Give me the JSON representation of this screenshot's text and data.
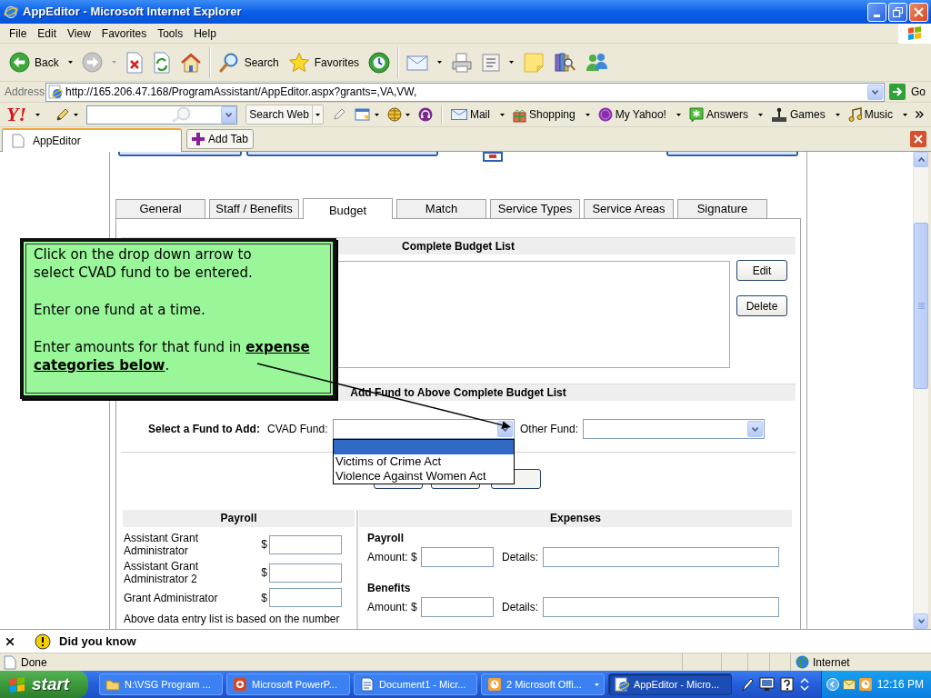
{
  "window": {
    "title": "AppEditor - Microsoft Internet Explorer"
  },
  "menu": [
    "File",
    "Edit",
    "View",
    "Favorites",
    "Tools",
    "Help"
  ],
  "toolbar": [
    {
      "kind": "back",
      "label": "Back",
      "dropdown": true
    },
    {
      "kind": "forward",
      "dropdown": true
    },
    {
      "kind": "stop"
    },
    {
      "kind": "refresh"
    },
    {
      "kind": "home"
    },
    {
      "kind": "separator"
    },
    {
      "kind": "search",
      "label": "Search"
    },
    {
      "kind": "favorites",
      "label": "Favorites"
    },
    {
      "kind": "history"
    },
    {
      "kind": "separator"
    },
    {
      "kind": "mail",
      "dropdown": true
    },
    {
      "kind": "print"
    },
    {
      "kind": "edit",
      "dropdown": true
    },
    {
      "kind": "note"
    },
    {
      "kind": "research"
    },
    {
      "kind": "messenger"
    }
  ],
  "address_bar": {
    "label": "Address",
    "url": "http://165.206.47.168/ProgramAssistant/AppEditor.aspx?grants=,VA,VW,",
    "go": "Go"
  },
  "yahoo_toolbar": {
    "items": [
      {
        "kind": "logo",
        "label": "Y!",
        "dropdown": true
      },
      {
        "kind": "pencil",
        "dropdown": true
      },
      {
        "kind": "search-field"
      },
      {
        "kind": "search-web",
        "label": "Search Web",
        "dropdown": true
      },
      {
        "kind": "highlight"
      },
      {
        "kind": "window",
        "dropdown": true
      },
      {
        "kind": "globe",
        "dropdown": true
      },
      {
        "kind": "headphones"
      },
      {
        "kind": "separator"
      },
      {
        "kind": "mail",
        "label": "Mail",
        "dropdown": true
      },
      {
        "kind": "shopping",
        "label": "Shopping",
        "dropdown": true
      },
      {
        "kind": "my-page",
        "label": "My Yahoo!",
        "dropdown": true
      },
      {
        "kind": "answers",
        "label": "Answers",
        "dropdown": true
      },
      {
        "kind": "games",
        "label": "Games",
        "dropdown": true
      },
      {
        "kind": "music",
        "label": "Music",
        "dropdown": true
      }
    ]
  },
  "browser_tabs": {
    "tabs": [
      {
        "label": "AppEditor",
        "selected": true
      }
    ],
    "add_tab": "Add Tab"
  },
  "page": {
    "tabs": [
      {
        "label": "General",
        "selected": false
      },
      {
        "label": "Staff / Benefits",
        "selected": false
      },
      {
        "label": "Budget",
        "selected": true
      },
      {
        "label": "Match",
        "selected": false
      },
      {
        "label": "Service Types",
        "selected": false
      },
      {
        "label": "Service Areas",
        "selected": false
      },
      {
        "label": "Signature",
        "selected": false
      }
    ],
    "budget_list": {
      "title": "Complete Budget List",
      "buttons": [
        "Edit",
        "Delete"
      ]
    },
    "add_fund": {
      "title": "Add Fund to Above Complete Budget List",
      "prompt": "Select a Fund to Add:",
      "cvad_fund": {
        "label": "CVAD Fund:",
        "expanded": true,
        "blank_option_highlighted": true,
        "options": [
          {
            "label": "Victims of Crime Act",
            "selected": false
          },
          {
            "label": "Violence Against Women Act",
            "selected": false
          }
        ]
      },
      "other_fund": {
        "label": "Other Fund:"
      }
    },
    "payroll": {
      "title": "Payroll",
      "rows": [
        {
          "label": "Assistant Grant Administrator",
          "currency": "$"
        },
        {
          "label": "Assistant Grant Administrator 2",
          "currency": "$"
        },
        {
          "label": "Grant Administrator",
          "currency": "$"
        }
      ],
      "note": "Above data entry list is based on the number"
    },
    "expenses": {
      "title": "Expenses",
      "groups": [
        {
          "title": "Payroll",
          "amount_label": "Amount: $",
          "details_label": "Details:"
        },
        {
          "title": "Benefits",
          "amount_label": "Amount: $",
          "details_label": "Details:"
        }
      ]
    }
  },
  "callout": {
    "paragraphs": [
      [
        "Click on the drop down arrow to",
        "select CVAD fund to be entered."
      ],
      [
        "Enter one fund at a time."
      ],
      [
        "Enter amounts for that fund in **expense**",
        "**categories below**."
      ]
    ]
  },
  "info_bar": {
    "text": "Did you know"
  },
  "status_bar": {
    "text": "Done",
    "zone": "Internet"
  },
  "taskbar": {
    "start": "start",
    "tasks": [
      {
        "kind": "folder",
        "label": "N:\\VSG Program ...",
        "selected": false
      },
      {
        "kind": "slides",
        "label": "Microsoft PowerP...",
        "selected": false
      },
      {
        "kind": "document",
        "label": "Document1 - Micr...",
        "selected": false
      },
      {
        "kind": "group",
        "label": "2 Microsoft Offi...",
        "selected": false,
        "dropdown": true
      },
      {
        "kind": "browser",
        "label": "AppEditor - Micro...",
        "selected": true
      }
    ],
    "clock": "12:16 PM"
  }
}
